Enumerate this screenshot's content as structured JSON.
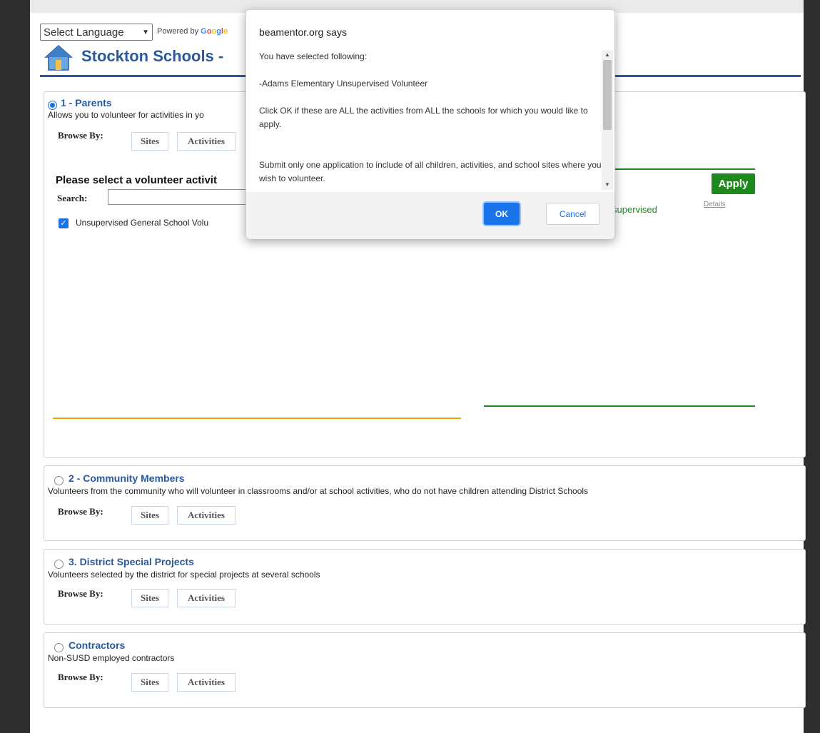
{
  "header": {
    "language_select": "Select Language",
    "powered_by": "Powered by",
    "google": [
      "G",
      "o",
      "o",
      "g",
      "l",
      "e"
    ],
    "site_title": "Stockton Schools -"
  },
  "sections": [
    {
      "title": "1 - Parents",
      "description": "Allows you to volunteer for activities in yo",
      "selected": true,
      "browse_label": "Browse By:",
      "tabs": [
        "Sites",
        "Activities"
      ]
    },
    {
      "title": "2 - Community Members",
      "description": "Volunteers from the community who will volunteer in classrooms and/or at school activities, who do not have children attending District Schools",
      "selected": false,
      "browse_label": "Browse By:",
      "tabs": [
        "Sites",
        "Activities"
      ]
    },
    {
      "title": "3. District Special Projects",
      "description": "Volunteers selected by the district for special projects at several schools",
      "selected": false,
      "browse_label": "Browse By:",
      "tabs": [
        "Sites",
        "Activities"
      ]
    },
    {
      "title": "Contractors",
      "description": "Non-SUSD employed contractors",
      "selected": false,
      "browse_label": "Browse By:",
      "tabs": [
        "Sites",
        "Activities"
      ]
    }
  ],
  "volunteer_panel": {
    "heading": "Please select a volunteer activit",
    "search_label": "Search:",
    "search_value": "",
    "checked_item": "Unsupervised General School Volu",
    "apply_label": "Apply",
    "selected_text": "supervised",
    "details_link": "Details"
  },
  "dialog": {
    "title": "beamentor.org says",
    "body": [
      "You have selected following:",
      "-Adams Elementary Unsupervised Volunteer",
      "Click OK if these are ALL the activities from ALL the schools for which you would like to apply.",
      "Submit only one application to include of all children, activities, and school sites where you wish to volunteer."
    ],
    "ok_label": "OK",
    "cancel_label": "Cancel"
  },
  "colors": {
    "brand_blue": "#2a5a9e",
    "apply_green": "#1e8a1e",
    "accent_orange": "#f0a500",
    "ok_blue": "#1a73e8"
  }
}
